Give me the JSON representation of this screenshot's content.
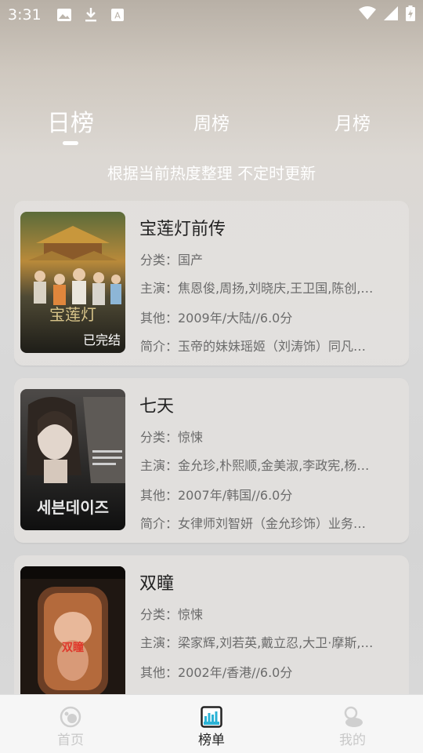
{
  "status_bar": {
    "time": "3:31",
    "icons": [
      "image-icon",
      "download-icon",
      "a-icon",
      "wifi-icon",
      "signal-icon",
      "battery-icon"
    ]
  },
  "tabs": [
    {
      "label": "日榜",
      "active": true
    },
    {
      "label": "周榜",
      "active": false
    },
    {
      "label": "月榜",
      "active": false
    }
  ],
  "subtitle": "根据当前热度整理 不定时更新",
  "items": [
    {
      "title": "宝莲灯前传",
      "badge": "已完结",
      "category": "分类：国产",
      "cast": "主演：焦恩俊,周扬,刘晓庆,王卫国,陈创,…",
      "other": "其他：2009年/大陆//6.0分",
      "intro": "简介：玉帝的妹妹瑶姬（刘涛饰）同凡…"
    },
    {
      "title": "七天",
      "badge": "",
      "category": "分类：惊悚",
      "cast": "主演：金允珍,朴熙顺,金美淑,李政宪,杨…",
      "other": "其他：2007年/韩国//6.0分",
      "intro": "简介：女律师刘智妍（金允珍饰）业务…"
    },
    {
      "title": "双瞳",
      "badge": "",
      "category": "分类：惊悚",
      "cast": "主演：梁家辉,刘若英,戴立忍,大卫·摩斯,…",
      "other": "其他：2002年/香港//6.0分",
      "intro": ""
    }
  ],
  "bottom_nav": [
    {
      "label": "首页",
      "icon": "home-icon",
      "active": false
    },
    {
      "label": "榜单",
      "icon": "chart-icon",
      "active": true
    },
    {
      "label": "我的",
      "icon": "profile-icon",
      "active": false
    }
  ],
  "colors": {
    "accent": "#2bb3d6",
    "inactive_nav": "#c8c8c8",
    "active_nav": "#222222"
  }
}
